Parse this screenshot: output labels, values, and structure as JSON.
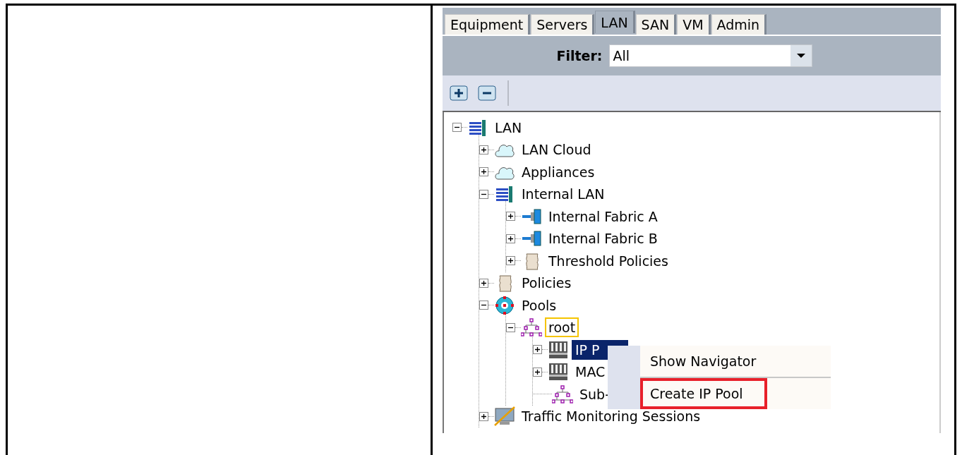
{
  "tabs": [
    {
      "label": "Equipment",
      "selected": false
    },
    {
      "label": "Servers",
      "selected": false
    },
    {
      "label": "LAN",
      "selected": true
    },
    {
      "label": "SAN",
      "selected": false
    },
    {
      "label": "VM",
      "selected": false
    },
    {
      "label": "Admin",
      "selected": false
    }
  ],
  "filter": {
    "label": "Filter:",
    "value": "All"
  },
  "tree": [
    {
      "label": "LAN",
      "kind": "lan",
      "expanded": true,
      "selected": false,
      "focused": false,
      "children": [
        {
          "label": "LAN Cloud",
          "kind": "cloud",
          "expanded": false,
          "selected": false,
          "focused": false
        },
        {
          "label": "Appliances",
          "kind": "cloud",
          "expanded": false,
          "selected": false,
          "focused": false
        },
        {
          "label": "Internal LAN",
          "kind": "lan",
          "expanded": true,
          "selected": false,
          "focused": false,
          "children": [
            {
              "label": "Internal Fabric A",
              "kind": "fabric",
              "expanded": false,
              "selected": false,
              "focused": false
            },
            {
              "label": "Internal Fabric B",
              "kind": "fabric",
              "expanded": false,
              "selected": false,
              "focused": false
            },
            {
              "label": "Threshold Policies",
              "kind": "scroll",
              "expanded": false,
              "selected": false,
              "focused": false
            }
          ]
        },
        {
          "label": "Policies",
          "kind": "scroll",
          "expanded": false,
          "selected": false,
          "focused": false
        },
        {
          "label": "Pools",
          "kind": "pools",
          "expanded": true,
          "selected": false,
          "focused": false,
          "children": [
            {
              "label": "root",
              "kind": "org",
              "expanded": true,
              "selected": false,
              "focused": true,
              "children": [
                {
                  "label": "IP P",
                  "kind": "rack",
                  "expanded": false,
                  "selected": true,
                  "focused": false
                },
                {
                  "label": "MAC",
                  "kind": "rack",
                  "expanded": false,
                  "selected": false,
                  "focused": false
                },
                {
                  "label": "Sub-",
                  "kind": "org",
                  "selected": false,
                  "focused": false
                }
              ]
            }
          ]
        },
        {
          "label": "Traffic Monitoring Sessions",
          "kind": "monitor",
          "expanded": false,
          "selected": false,
          "focused": false
        }
      ]
    }
  ],
  "context_menu": [
    {
      "label": "Show Navigator",
      "highlighted": false
    },
    {
      "label": "Create IP Pool",
      "highlighted": true
    }
  ]
}
